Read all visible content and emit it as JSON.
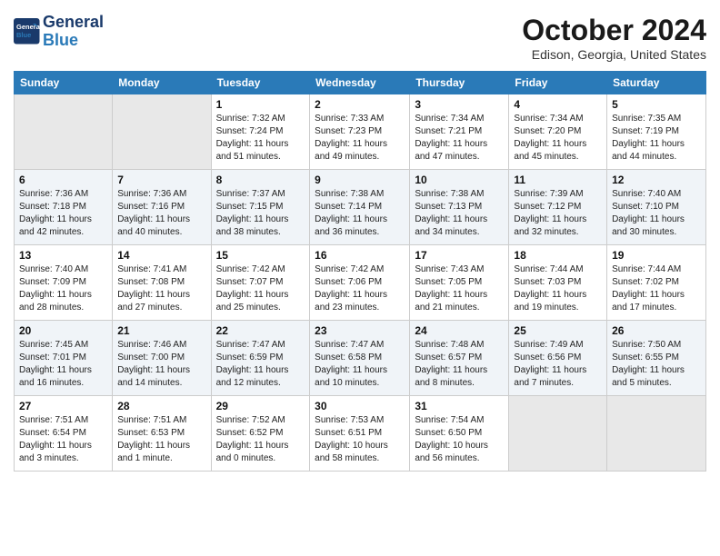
{
  "header": {
    "logo_line1": "General",
    "logo_line2": "Blue",
    "month_title": "October 2024",
    "location": "Edison, Georgia, United States"
  },
  "weekdays": [
    "Sunday",
    "Monday",
    "Tuesday",
    "Wednesday",
    "Thursday",
    "Friday",
    "Saturday"
  ],
  "weeks": [
    [
      {
        "day": "",
        "sunrise": "",
        "sunset": "",
        "daylight": ""
      },
      {
        "day": "",
        "sunrise": "",
        "sunset": "",
        "daylight": ""
      },
      {
        "day": "1",
        "sunrise": "Sunrise: 7:32 AM",
        "sunset": "Sunset: 7:24 PM",
        "daylight": "Daylight: 11 hours and 51 minutes."
      },
      {
        "day": "2",
        "sunrise": "Sunrise: 7:33 AM",
        "sunset": "Sunset: 7:23 PM",
        "daylight": "Daylight: 11 hours and 49 minutes."
      },
      {
        "day": "3",
        "sunrise": "Sunrise: 7:34 AM",
        "sunset": "Sunset: 7:21 PM",
        "daylight": "Daylight: 11 hours and 47 minutes."
      },
      {
        "day": "4",
        "sunrise": "Sunrise: 7:34 AM",
        "sunset": "Sunset: 7:20 PM",
        "daylight": "Daylight: 11 hours and 45 minutes."
      },
      {
        "day": "5",
        "sunrise": "Sunrise: 7:35 AM",
        "sunset": "Sunset: 7:19 PM",
        "daylight": "Daylight: 11 hours and 44 minutes."
      }
    ],
    [
      {
        "day": "6",
        "sunrise": "Sunrise: 7:36 AM",
        "sunset": "Sunset: 7:18 PM",
        "daylight": "Daylight: 11 hours and 42 minutes."
      },
      {
        "day": "7",
        "sunrise": "Sunrise: 7:36 AM",
        "sunset": "Sunset: 7:16 PM",
        "daylight": "Daylight: 11 hours and 40 minutes."
      },
      {
        "day": "8",
        "sunrise": "Sunrise: 7:37 AM",
        "sunset": "Sunset: 7:15 PM",
        "daylight": "Daylight: 11 hours and 38 minutes."
      },
      {
        "day": "9",
        "sunrise": "Sunrise: 7:38 AM",
        "sunset": "Sunset: 7:14 PM",
        "daylight": "Daylight: 11 hours and 36 minutes."
      },
      {
        "day": "10",
        "sunrise": "Sunrise: 7:38 AM",
        "sunset": "Sunset: 7:13 PM",
        "daylight": "Daylight: 11 hours and 34 minutes."
      },
      {
        "day": "11",
        "sunrise": "Sunrise: 7:39 AM",
        "sunset": "Sunset: 7:12 PM",
        "daylight": "Daylight: 11 hours and 32 minutes."
      },
      {
        "day": "12",
        "sunrise": "Sunrise: 7:40 AM",
        "sunset": "Sunset: 7:10 PM",
        "daylight": "Daylight: 11 hours and 30 minutes."
      }
    ],
    [
      {
        "day": "13",
        "sunrise": "Sunrise: 7:40 AM",
        "sunset": "Sunset: 7:09 PM",
        "daylight": "Daylight: 11 hours and 28 minutes."
      },
      {
        "day": "14",
        "sunrise": "Sunrise: 7:41 AM",
        "sunset": "Sunset: 7:08 PM",
        "daylight": "Daylight: 11 hours and 27 minutes."
      },
      {
        "day": "15",
        "sunrise": "Sunrise: 7:42 AM",
        "sunset": "Sunset: 7:07 PM",
        "daylight": "Daylight: 11 hours and 25 minutes."
      },
      {
        "day": "16",
        "sunrise": "Sunrise: 7:42 AM",
        "sunset": "Sunset: 7:06 PM",
        "daylight": "Daylight: 11 hours and 23 minutes."
      },
      {
        "day": "17",
        "sunrise": "Sunrise: 7:43 AM",
        "sunset": "Sunset: 7:05 PM",
        "daylight": "Daylight: 11 hours and 21 minutes."
      },
      {
        "day": "18",
        "sunrise": "Sunrise: 7:44 AM",
        "sunset": "Sunset: 7:03 PM",
        "daylight": "Daylight: 11 hours and 19 minutes."
      },
      {
        "day": "19",
        "sunrise": "Sunrise: 7:44 AM",
        "sunset": "Sunset: 7:02 PM",
        "daylight": "Daylight: 11 hours and 17 minutes."
      }
    ],
    [
      {
        "day": "20",
        "sunrise": "Sunrise: 7:45 AM",
        "sunset": "Sunset: 7:01 PM",
        "daylight": "Daylight: 11 hours and 16 minutes."
      },
      {
        "day": "21",
        "sunrise": "Sunrise: 7:46 AM",
        "sunset": "Sunset: 7:00 PM",
        "daylight": "Daylight: 11 hours and 14 minutes."
      },
      {
        "day": "22",
        "sunrise": "Sunrise: 7:47 AM",
        "sunset": "Sunset: 6:59 PM",
        "daylight": "Daylight: 11 hours and 12 minutes."
      },
      {
        "day": "23",
        "sunrise": "Sunrise: 7:47 AM",
        "sunset": "Sunset: 6:58 PM",
        "daylight": "Daylight: 11 hours and 10 minutes."
      },
      {
        "day": "24",
        "sunrise": "Sunrise: 7:48 AM",
        "sunset": "Sunset: 6:57 PM",
        "daylight": "Daylight: 11 hours and 8 minutes."
      },
      {
        "day": "25",
        "sunrise": "Sunrise: 7:49 AM",
        "sunset": "Sunset: 6:56 PM",
        "daylight": "Daylight: 11 hours and 7 minutes."
      },
      {
        "day": "26",
        "sunrise": "Sunrise: 7:50 AM",
        "sunset": "Sunset: 6:55 PM",
        "daylight": "Daylight: 11 hours and 5 minutes."
      }
    ],
    [
      {
        "day": "27",
        "sunrise": "Sunrise: 7:51 AM",
        "sunset": "Sunset: 6:54 PM",
        "daylight": "Daylight: 11 hours and 3 minutes."
      },
      {
        "day": "28",
        "sunrise": "Sunrise: 7:51 AM",
        "sunset": "Sunset: 6:53 PM",
        "daylight": "Daylight: 11 hours and 1 minute."
      },
      {
        "day": "29",
        "sunrise": "Sunrise: 7:52 AM",
        "sunset": "Sunset: 6:52 PM",
        "daylight": "Daylight: 11 hours and 0 minutes."
      },
      {
        "day": "30",
        "sunrise": "Sunrise: 7:53 AM",
        "sunset": "Sunset: 6:51 PM",
        "daylight": "Daylight: 10 hours and 58 minutes."
      },
      {
        "day": "31",
        "sunrise": "Sunrise: 7:54 AM",
        "sunset": "Sunset: 6:50 PM",
        "daylight": "Daylight: 10 hours and 56 minutes."
      },
      {
        "day": "",
        "sunrise": "",
        "sunset": "",
        "daylight": ""
      },
      {
        "day": "",
        "sunrise": "",
        "sunset": "",
        "daylight": ""
      }
    ]
  ]
}
